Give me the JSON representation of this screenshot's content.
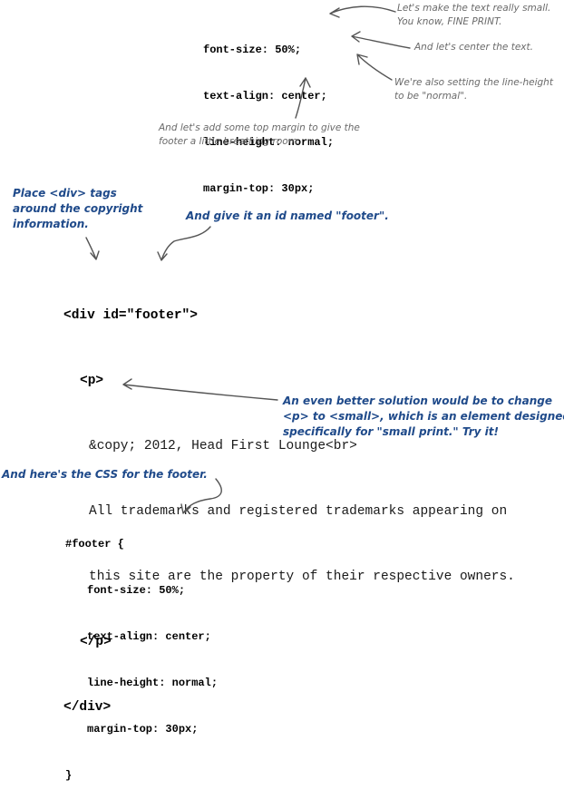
{
  "top_css": {
    "lines": [
      "font-size: 50%;",
      "text-align: center;",
      "line-height: normal;",
      "margin-top: 30px;"
    ]
  },
  "top_notes": {
    "fine_print": "Let's make the text really small.\nYou know, FINE PRINT.",
    "center": "And let's center the text.",
    "line_height": "We're also setting the line-height\nto be \"normal\".",
    "margin": "And let's add some top margin to give the\nfooter a little breathing room."
  },
  "html_notes": {
    "div_tags": "Place <div> tags\naround the copyright\ninformation.",
    "footer_id": "And give it an id named \"footer\".",
    "small_tip": "An even better solution would be to change\n<p> to <small>, which is an element designed\nspecifically for \"small print.\" Try it!"
  },
  "html_code": {
    "div_open": "<div id=\"footer\">",
    "p_open": "<p>",
    "line1": "&copy; 2012, Head First Lounge<br>",
    "line2": "All trademarks and registered trademarks appearing on",
    "line3": "this site are the property of their respective owners.",
    "p_close": "</p>",
    "div_close": "</div>"
  },
  "bottom": {
    "note": "And here's the CSS for the footer.",
    "selector": "#footer {",
    "lines": [
      "font-size: 50%;",
      "text-align: center;",
      "line-height: normal;",
      "margin-top: 30px;"
    ],
    "close": "}"
  }
}
